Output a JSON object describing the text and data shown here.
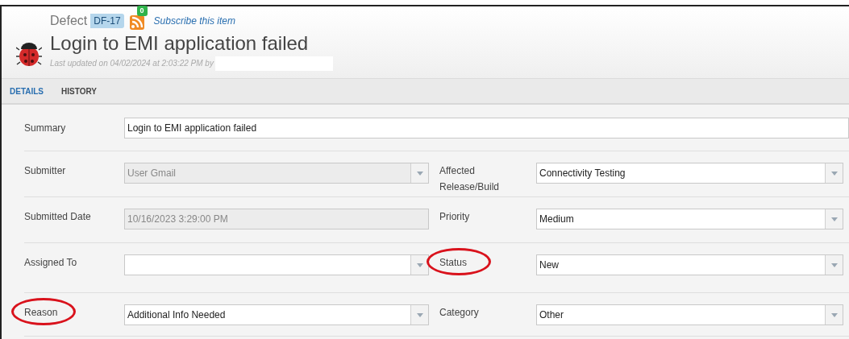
{
  "header": {
    "type_label": "Defect",
    "id_badge": "DF-17",
    "feed_count": "0",
    "subscribe_link": "Subscribe this item",
    "title": "Login to EMI application failed",
    "last_updated": "Last updated on 04/02/2024 at 2:03:22 PM by"
  },
  "tabs": [
    {
      "label": "DETAILS",
      "selected": true
    },
    {
      "label": "HISTORY",
      "selected": false
    }
  ],
  "summary": {
    "label": "Summary",
    "value": "Login to EMI application failed",
    "kind": "text",
    "disabled": false,
    "circled": false
  },
  "rows": [
    [
      {
        "label": "Submitter",
        "value": "User Gmail",
        "kind": "select",
        "disabled": true,
        "circled": false
      },
      {
        "label": "Affected Release/Build",
        "value": "Connectivity Testing",
        "kind": "select",
        "disabled": false,
        "circled": false
      }
    ],
    [
      {
        "label": "Submitted Date",
        "value": "10/16/2023 3:29:00 PM",
        "kind": "text",
        "disabled": true,
        "circled": false
      },
      {
        "label": "Priority",
        "value": "Medium",
        "kind": "select",
        "disabled": false,
        "circled": false
      }
    ],
    [
      {
        "label": "Assigned To",
        "kind": "select",
        "disabled": false,
        "circled": false
      },
      {
        "label": "Status",
        "value": "New",
        "kind": "select",
        "disabled": false,
        "circled": true
      }
    ],
    [
      {
        "label": "Reason",
        "value": "Additional Info Needed",
        "kind": "select",
        "disabled": false,
        "circled": true
      },
      {
        "label": "Category",
        "value": "Other",
        "kind": "select",
        "disabled": false,
        "circled": false
      }
    ]
  ]
}
